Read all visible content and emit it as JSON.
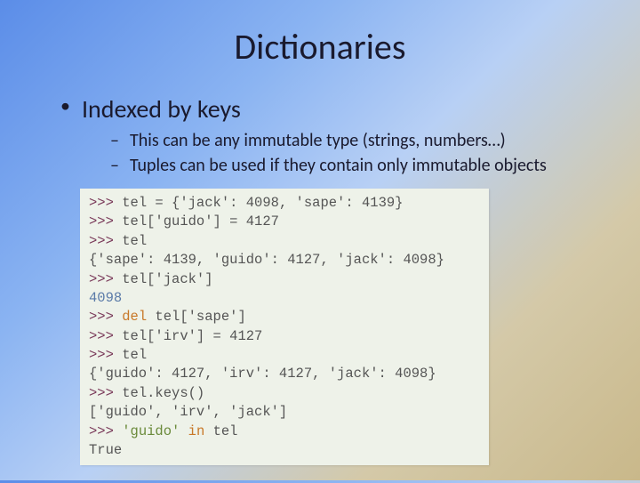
{
  "title": "Dictionaries",
  "bullets": {
    "main": "Indexed by keys",
    "sub1": "This can be any immutable type (strings, numbers…)",
    "sub2": "Tuples can be used if they contain only immutable objects"
  },
  "code": {
    "l1_prompt": ">>> ",
    "l1_code": "tel = {'jack': 4098, 'sape': 4139}",
    "l2_prompt": ">>> ",
    "l2_code": "tel['guido'] = 4127",
    "l3_prompt": ">>> ",
    "l3_code": "tel",
    "l4_out": "{'sape': 4139, 'guido': 4127, 'jack': 4098}",
    "l5_prompt": ">>> ",
    "l5_code": "tel['jack']",
    "l6_out": "4098",
    "l7_prompt": ">>> ",
    "l7_kw": "del",
    "l7_code": " tel['sape']",
    "l8_prompt": ">>> ",
    "l8_code": "tel['irv'] = 4127",
    "l9_prompt": ">>> ",
    "l9_code": "tel",
    "l10_out": "{'guido': 4127, 'irv': 4127, 'jack': 4098}",
    "l11_prompt": ">>> ",
    "l11_code": "tel.keys()",
    "l12_out": "['guido', 'irv', 'jack']",
    "l13_prompt": ">>> ",
    "l13_str": "'guido'",
    "l13_kw": " in ",
    "l13_code": "tel",
    "l14_out": "True"
  }
}
